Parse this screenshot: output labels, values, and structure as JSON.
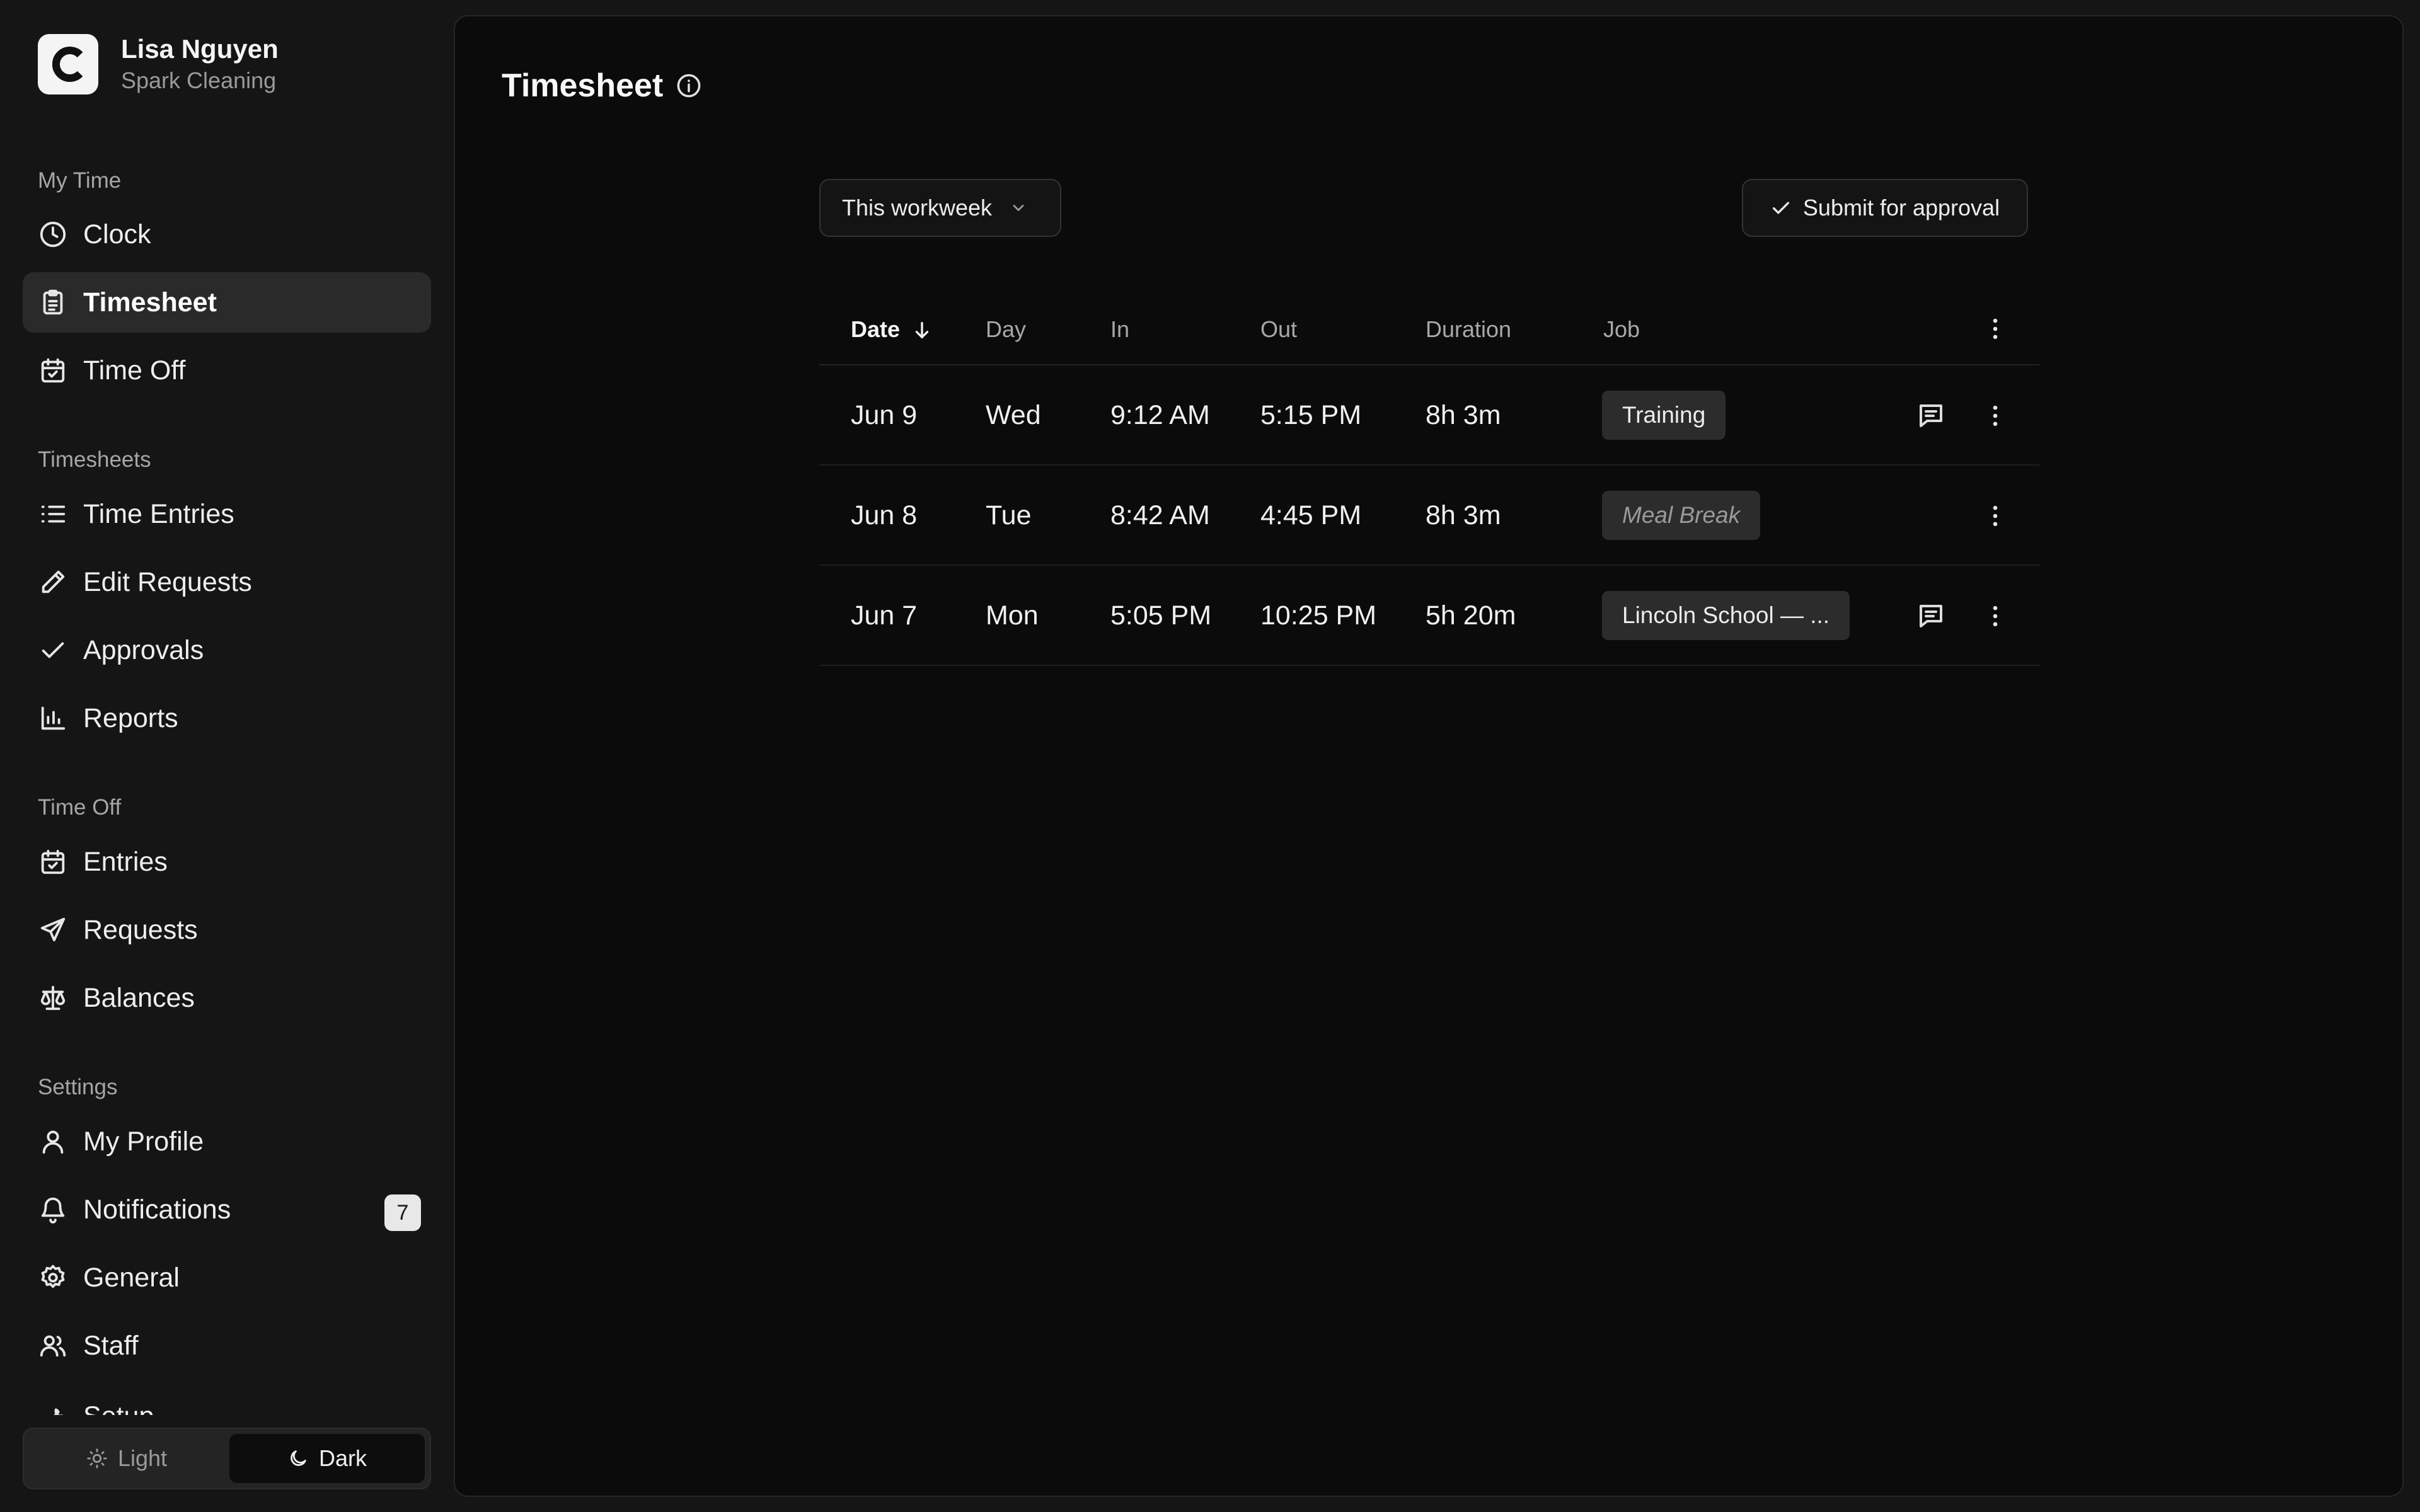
{
  "user": {
    "name": "Lisa Nguyen",
    "org": "Spark Cleaning",
    "logo_letter": "C"
  },
  "sidebar": {
    "sections": [
      {
        "label": "My Time"
      },
      {
        "label": "Timesheets"
      },
      {
        "label": "Time Off"
      },
      {
        "label": "Settings"
      }
    ],
    "my_time": [
      {
        "label": "Clock",
        "icon": "clock-icon"
      },
      {
        "label": "Timesheet",
        "icon": "clipboard-icon",
        "active": true
      },
      {
        "label": "Time Off",
        "icon": "calendar-check-icon"
      }
    ],
    "timesheets": [
      {
        "label": "Time Entries",
        "icon": "list-icon"
      },
      {
        "label": "Edit Requests",
        "icon": "pencil-icon"
      },
      {
        "label": "Approvals",
        "icon": "check-icon"
      },
      {
        "label": "Reports",
        "icon": "bar-chart-icon"
      }
    ],
    "time_off": [
      {
        "label": "Entries",
        "icon": "calendar-check-icon"
      },
      {
        "label": "Requests",
        "icon": "send-icon"
      },
      {
        "label": "Balances",
        "icon": "scale-icon"
      }
    ],
    "settings": [
      {
        "label": "My Profile",
        "icon": "user-icon"
      },
      {
        "label": "Notifications",
        "icon": "bell-icon",
        "badge": "7"
      },
      {
        "label": "General",
        "icon": "gear-icon"
      },
      {
        "label": "Staff",
        "icon": "users-icon"
      },
      {
        "label": "Setup",
        "icon": "wrench-icon"
      }
    ],
    "theme": {
      "light_label": "Light",
      "dark_label": "Dark",
      "selected": "Dark"
    }
  },
  "main": {
    "title": "Timesheet",
    "period": "This workweek",
    "submit_label": "Submit for approval",
    "columns": {
      "date": "Date",
      "day": "Day",
      "in": "In",
      "out": "Out",
      "duration": "Duration",
      "job": "Job"
    },
    "sort": {
      "column": "Date",
      "direction": "descending"
    },
    "rows": [
      {
        "date": "Jun 9",
        "day": "Wed",
        "in": "9:12 AM",
        "out": "5:15 PM",
        "duration": "8h 3m",
        "job": "Training",
        "job_muted": false,
        "has_note": true
      },
      {
        "date": "Jun 8",
        "day": "Tue",
        "in": "8:42 AM",
        "out": "4:45 PM",
        "duration": "8h 3m",
        "job": "Meal Break",
        "job_muted": true,
        "has_note": false
      },
      {
        "date": "Jun 7",
        "day": "Mon",
        "in": "5:05 PM",
        "out": "10:25 PM",
        "duration": "5h 20m",
        "job": "Lincoln School — ...",
        "job_muted": false,
        "has_note": true
      }
    ]
  },
  "colors": {
    "background": "#151515",
    "panel": "#0b0b0b",
    "active_nav": "#2a2a2a",
    "tag": "#2c2c2c",
    "text": "#f0f0f0",
    "muted": "#a6a6a6"
  }
}
